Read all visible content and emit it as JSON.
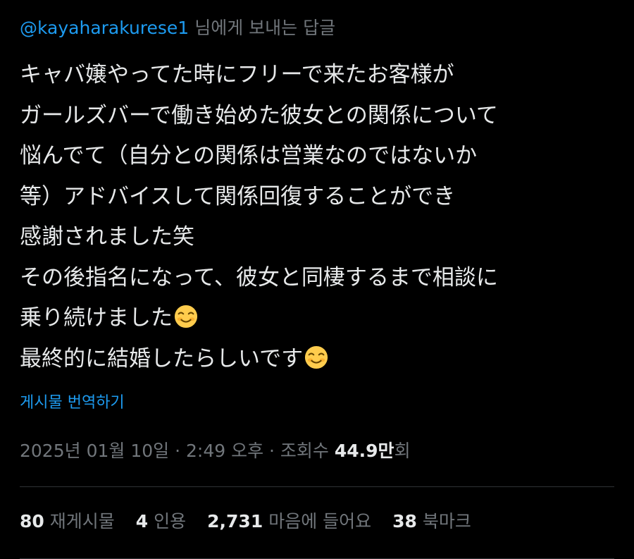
{
  "reply": {
    "handle": "@kayaharakurese1",
    "suffix": "님에게 보내는 답글"
  },
  "body": {
    "lines": [
      {
        "text": "キャバ嬢やってた時にフリーで来たお客様が",
        "emoji": ""
      },
      {
        "text": "ガールズバーで働き始めた彼女との関係について",
        "emoji": ""
      },
      {
        "text": "悩んでて（自分との関係は営業なのではないか",
        "emoji": ""
      },
      {
        "text": "等）アドバイスして関係回復することができ",
        "emoji": ""
      },
      {
        "text": "感謝されました笑",
        "emoji": ""
      },
      {
        "text": "その後指名になって、彼女と同棲するまで相談に",
        "emoji": ""
      },
      {
        "text": "乗り続けました",
        "emoji": "smiling-face-icon"
      },
      {
        "text": "最終的に結婚したらしいです",
        "emoji": "smiling-face-icon"
      }
    ]
  },
  "translate_label": "게시물 번역하기",
  "meta": {
    "date": "2025년 01월 10일",
    "sep1": " · ",
    "time": "2:49 오후",
    "sep2": " · ",
    "views_label": "조회수 ",
    "views_num": "44.9만",
    "views_unit": "회"
  },
  "stats": {
    "reposts": {
      "num": "80",
      "label": "재게시물"
    },
    "quotes": {
      "num": "4",
      "label": "인용"
    },
    "likes": {
      "num": "2,731",
      "label": "마음에 들어요"
    },
    "bookmarks": {
      "num": "38",
      "label": "북마크"
    }
  },
  "colors": {
    "background": "#000000",
    "text": "#e7e9ea",
    "muted": "#71767b",
    "link": "#1d9bf0",
    "divider": "#2f3336",
    "emoji_face": "#ffcc4d"
  }
}
